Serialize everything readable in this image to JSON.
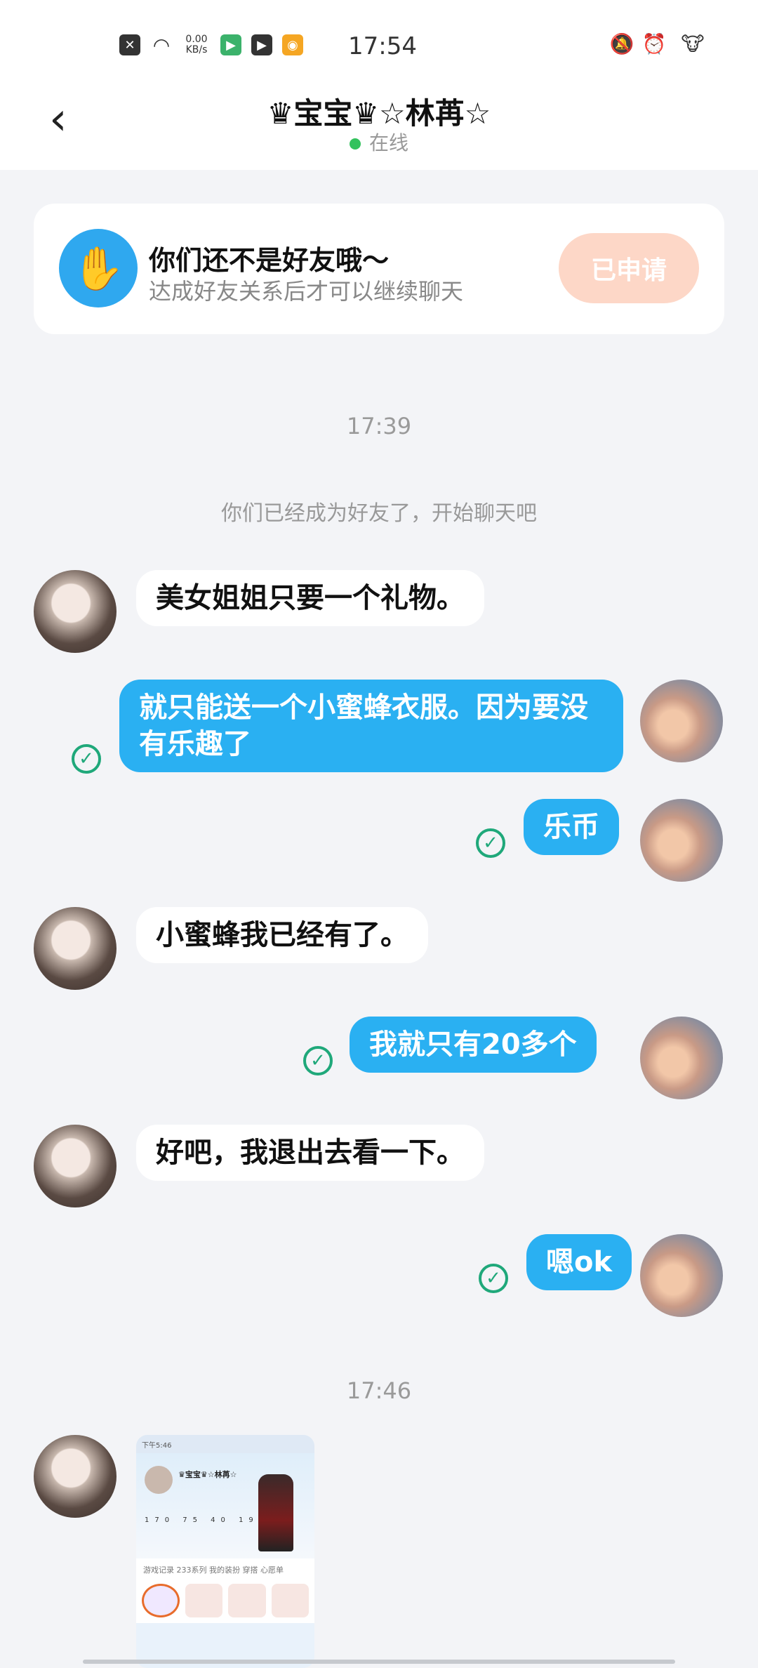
{
  "status_bar": {
    "time": "17:54",
    "net_speed_value": "0.00",
    "net_speed_unit": "KB/s",
    "icons": [
      "sim-off-icon",
      "wifi-icon",
      "app-icon",
      "video-icon",
      "weibo-icon",
      "mute-icon",
      "alarm-icon",
      "cow-avatar-icon"
    ]
  },
  "header": {
    "back_icon": "chevron-left-icon",
    "title": "♛宝宝♛☆林苒☆",
    "status": "在线",
    "status_color": "#33c25d"
  },
  "friend_card": {
    "icon": "hand-wave-icon",
    "title": "你们还不是好友哦～",
    "subtitle": "达成好友关系后才可以继续聊天",
    "button_label": "已申请"
  },
  "chat": {
    "timestamp_1": "17:39",
    "system_message": "你们已经成为好友了，开始聊天吧",
    "messages": [
      {
        "side": "in",
        "text": "美女姐姐只要一个礼物。"
      },
      {
        "side": "out",
        "text": "就只能送一个小蜜蜂衣服。因为要没有乐趣了"
      },
      {
        "side": "out",
        "text": "乐币"
      },
      {
        "side": "in",
        "text": "小蜜蜂我已经有了。"
      },
      {
        "side": "out",
        "text": "我就只有20多个"
      },
      {
        "side": "in",
        "text": "好吧，我退出去看一下。"
      },
      {
        "side": "out",
        "text": "嗯ok"
      }
    ],
    "timestamp_2": "17:46",
    "image_message": {
      "statusbar": "下午5:46",
      "name": "♛宝宝♛☆林苒☆",
      "stats": "170 75 40 19",
      "tabs": "游戏记录  233系列  我的装扮  穿搭  心愿单"
    }
  },
  "colors": {
    "outgoing_bubble": "#2ab0f2",
    "incoming_bubble": "#ffffff",
    "read_check": "#1fa87a",
    "applied_button": "#fdd7c7"
  }
}
